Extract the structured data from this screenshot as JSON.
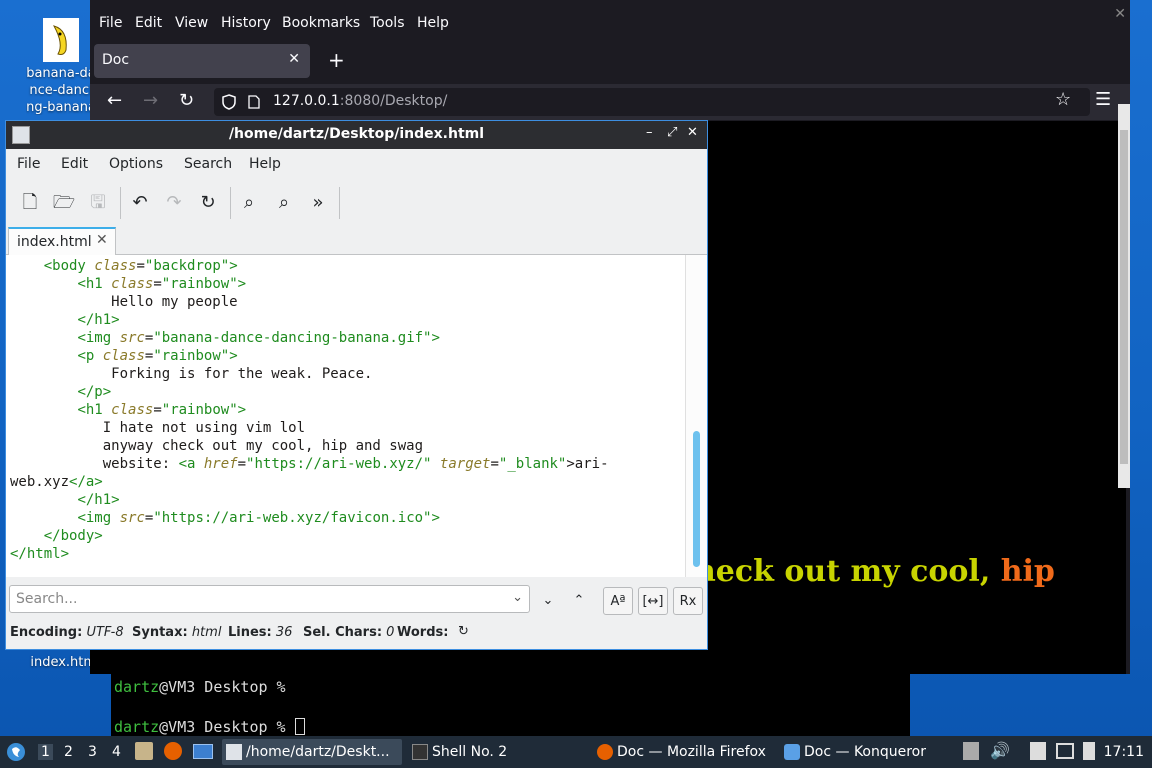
{
  "desktop": {
    "icons": [
      {
        "label": "banana-dance-dancing-banana"
      },
      {
        "label": "index.html"
      }
    ]
  },
  "terminal": {
    "lines": [
      {
        "user": "dartz",
        "host": "@VM3 Desktop %"
      },
      {
        "user": "dartz",
        "host": "@VM3 Desktop %"
      }
    ]
  },
  "firefox": {
    "title": "Doc — Mozilla Firefox",
    "menu": [
      "File",
      "Edit",
      "View",
      "History",
      "Bookmarks",
      "Tools",
      "Help"
    ],
    "tab_title": "Doc",
    "url_host": "127.0.0.1",
    "url_path": ":8080/Desktop/",
    "page_text_parts": [
      {
        "text": "heck out my cool, ",
        "color": "#c8d400"
      },
      {
        "text": "hip",
        "color": "#f06a1a"
      }
    ],
    "colors": {
      "bg": "#1c1b22",
      "toolbar": "#2b2a33",
      "tab": "#42414d"
    }
  },
  "editor": {
    "title": "/home/dartz/Desktop/index.html",
    "menu": [
      "File",
      "Edit",
      "Options",
      "Search",
      "Help"
    ],
    "tab_label": "index.html",
    "search_placeholder": "Search...",
    "status": {
      "encoding_label": "Encoding:",
      "encoding_value": "UTF-8",
      "syntax_label": "Syntax:",
      "syntax_value": "html",
      "lines_label": "Lines:",
      "lines_value": "36",
      "selchars_label": "Sel. Chars:",
      "selchars_value": "0",
      "words_label": "Words:"
    },
    "code": {
      "l1": {
        "indent": "    ",
        "open": "<body",
        "attr": "class",
        "eq": "=",
        "val": "\"backdrop\"",
        "close": ">"
      },
      "l2": {
        "indent": "        ",
        "open": "<h1",
        "attr": "class",
        "eq": "=",
        "val": "\"rainbow\"",
        "close": ">"
      },
      "l3": {
        "text": "            Hello my people"
      },
      "l4": {
        "indent": "        ",
        "tag": "</h1>"
      },
      "l5": {
        "indent": "        ",
        "open": "<img",
        "attr": "src",
        "eq": "=",
        "val": "\"banana-dance-dancing-banana.gif\"",
        "close": ">"
      },
      "l6": {
        "indent": "        ",
        "open": "<p",
        "attr": "class",
        "eq": "=",
        "val": "\"rainbow\"",
        "close": ">"
      },
      "l7": {
        "text": "            Forking is for the weak. Peace."
      },
      "l8": {
        "indent": "        ",
        "tag": "</p>"
      },
      "l9": {
        "indent": "        ",
        "open": "<h1",
        "attr": "class",
        "eq": "=",
        "val": "\"rainbow\"",
        "close": ">"
      },
      "l10": {
        "text": "           I hate not using vim lol"
      },
      "l11": {
        "text": "           anyway check out my cool, hip and swag"
      },
      "l12": {
        "pre": "           website: ",
        "open": "<a",
        "attr1": "href",
        "val1": "\"https://ari-web.xyz/\"",
        "attr2": "target",
        "val2": "\"_blank\"",
        "after": ">ari-"
      },
      "l13": {
        "pre": "web.xyz",
        "tag": "</a>"
      },
      "l14": {
        "indent": "        ",
        "tag": "</h1>"
      },
      "l15": {
        "indent": "        ",
        "open": "<img",
        "attr": "src",
        "eq": "=",
        "val": "\"https://ari-web.xyz/favicon.ico\"",
        "close": ">"
      },
      "l16": {
        "indent": "    ",
        "tag": "</body>"
      },
      "l17": {
        "indent": "",
        "tag": "</html>"
      }
    }
  },
  "taskbar": {
    "workspaces": [
      "1",
      "2",
      "3",
      "4"
    ],
    "tasks": [
      {
        "label": "/home/dartz/Deskt..."
      },
      {
        "label": "Shell No. 2"
      },
      {
        "label": "Doc — Mozilla Firefox"
      },
      {
        "label": "Doc — Konqueror"
      }
    ],
    "clock": "17:11"
  }
}
